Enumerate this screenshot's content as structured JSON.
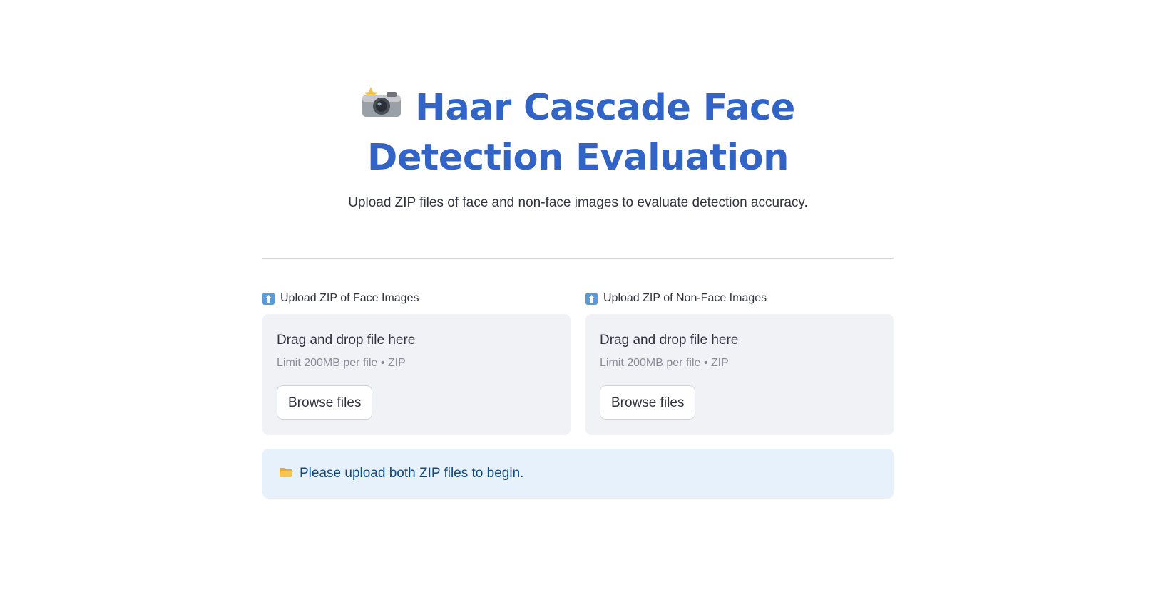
{
  "header": {
    "title": "Haar Cascade Face Detection Evaluation",
    "title_icon": "camera-with-flash-icon",
    "subtitle": "Upload ZIP files of face and non-face images to evaluate detection accuracy."
  },
  "uploaders": [
    {
      "label": "Upload ZIP of Face Images",
      "icon": "up-arrow-icon",
      "drop_text": "Drag and drop file here",
      "limit_text": "Limit 200MB per file • ZIP",
      "button_label": "Browse files"
    },
    {
      "label": "Upload ZIP of Non-Face Images",
      "icon": "up-arrow-icon",
      "drop_text": "Drag and drop file here",
      "limit_text": "Limit 200MB per file • ZIP",
      "button_label": "Browse files"
    }
  ],
  "info": {
    "icon": "open-folder-icon",
    "message": "Please upload both ZIP files to begin."
  },
  "colors": {
    "title": "#3264c8",
    "dropzone_bg": "#f0f2f6",
    "info_bg": "#e6f1fb",
    "info_text": "#0e4a83"
  }
}
